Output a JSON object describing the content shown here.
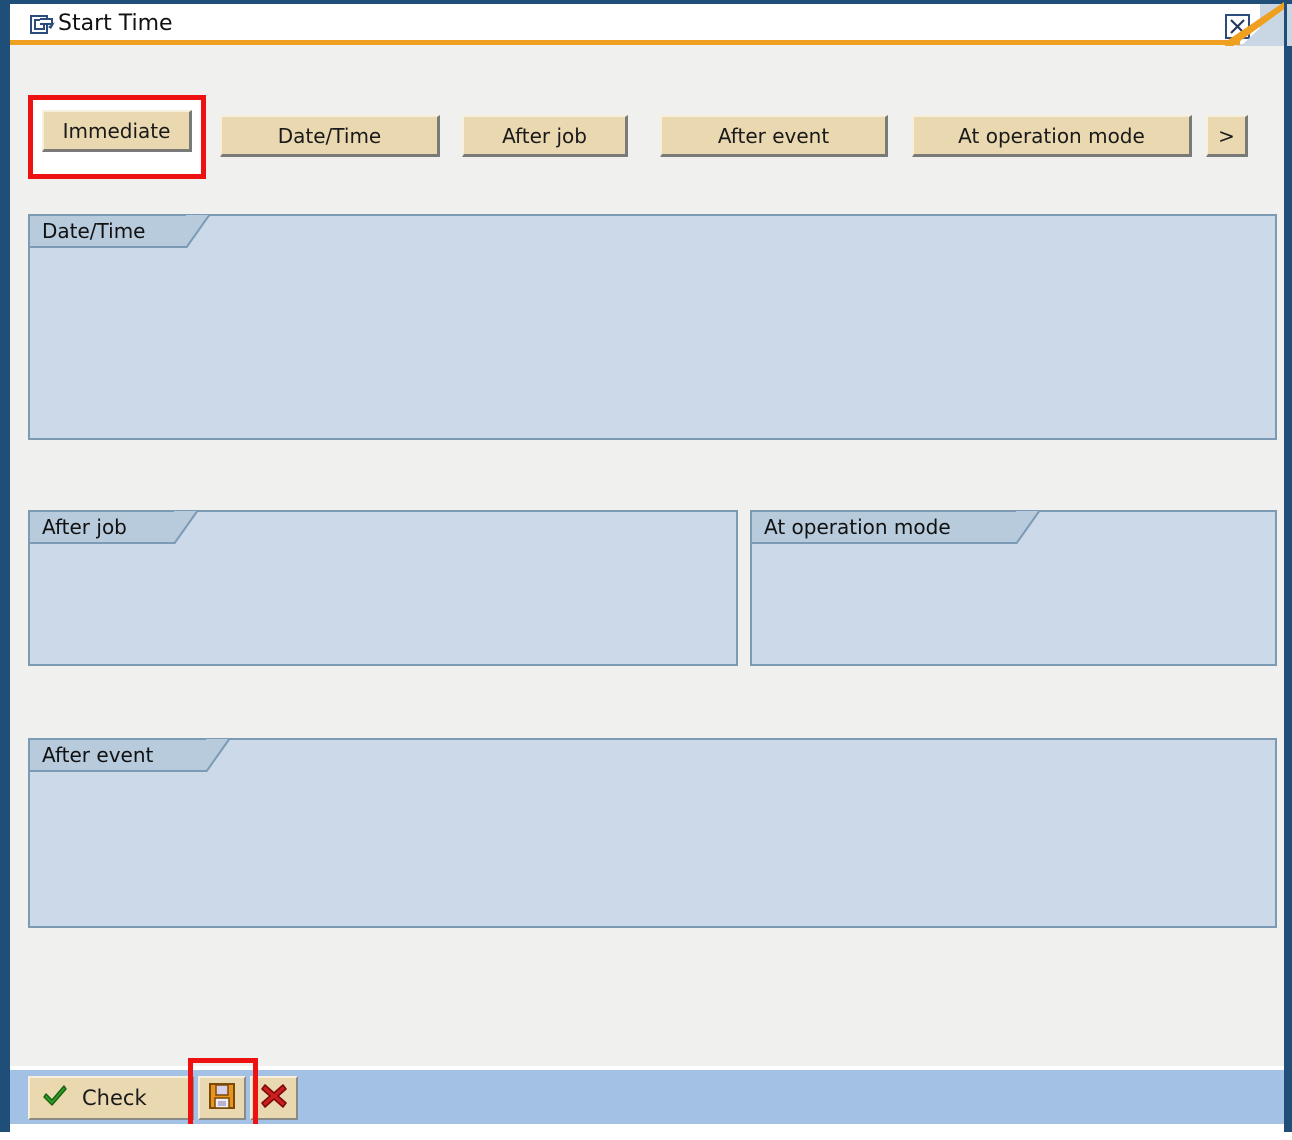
{
  "window": {
    "title": "Start Time",
    "title_icon": "dialog-edit-icon",
    "close_icon": "close-x-icon"
  },
  "toolbar": {
    "buttons": [
      {
        "label": "Immediate",
        "name": "immediate",
        "highlighted": true
      },
      {
        "label": "Date/Time",
        "name": "date-time",
        "highlighted": false
      },
      {
        "label": "After job",
        "name": "after-job",
        "highlighted": false
      },
      {
        "label": "After event",
        "name": "after-event",
        "highlighted": false
      },
      {
        "label": "At operation mode",
        "name": "at-operation-mode",
        "highlighted": false
      },
      {
        "label": ">",
        "name": "more",
        "highlighted": false
      }
    ]
  },
  "groups": [
    {
      "name": "date-time",
      "title": "Date/Time"
    },
    {
      "name": "after-job",
      "title": "After job"
    },
    {
      "name": "at-operation-mode",
      "title": "At operation mode"
    },
    {
      "name": "after-event",
      "title": "After event"
    }
  ],
  "bottom_toolbar": {
    "check_label": "Check",
    "check_icon": "green-check-icon",
    "save_icon": "floppy-disk-save-icon",
    "cancel_icon": "red-x-cancel-icon",
    "save_highlighted": true
  },
  "colors": {
    "frame_blue": "#1f4e79",
    "title_underline_orange": "#f0a020",
    "button_face": "#ead9b0",
    "groupbox_body": "#cbd9e8",
    "groupbox_tab": "#b7cbdd",
    "groupbox_border": "#7d9ab5",
    "bottom_bar_blue": "#a3c1e5",
    "annotation_red": "#ee1111",
    "dialog_background": "#f0f0ee"
  }
}
